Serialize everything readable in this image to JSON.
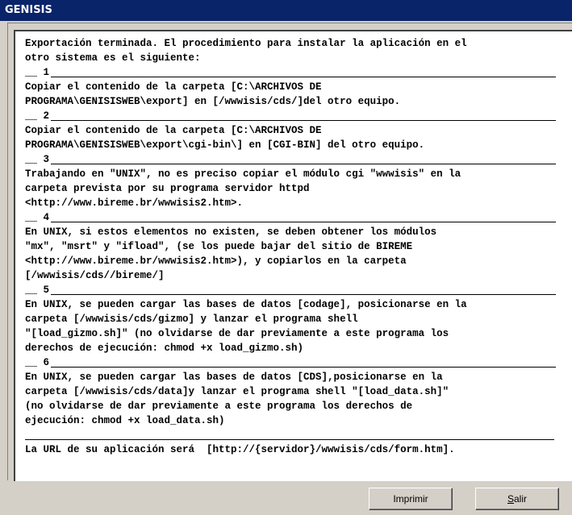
{
  "window": {
    "title": "GENISIS"
  },
  "message": {
    "intro": [
      "Exportación terminada. El procedimiento para instalar la aplicación en el",
      "otro sistema es el siguiente:"
    ],
    "steps": [
      {
        "number": "__ 1",
        "lines": [
          "Copiar el contenido de la carpeta [C:\\ARCHIVOS DE",
          "PROGRAMA\\GENISISWEB\\export] en [/wwwisis/cds/]del otro equipo."
        ]
      },
      {
        "number": "__ 2",
        "lines": [
          "Copiar el contenido de la carpeta [C:\\ARCHIVOS DE",
          "PROGRAMA\\GENISISWEB\\export\\cgi-bin\\] en [CGI-BIN] del otro equipo."
        ]
      },
      {
        "number": "__ 3",
        "lines": [
          "Trabajando en \"UNIX\", no es preciso copiar el módulo cgi \"wwwisis\" en la",
          "carpeta prevista por su programa servidor httpd",
          "<http://www.bireme.br/wwwisis2.htm>."
        ]
      },
      {
        "number": "__ 4",
        "lines": [
          "En UNIX, si estos elementos no existen, se deben obtener los módulos",
          "\"mx\", \"msrt\" y \"ifload\", (se los puede bajar del sitio de BIREME",
          "<http://www.bireme.br/wwwisis2.htm>), y copiarlos en la carpeta",
          "[/wwwisis/cds//bireme/]"
        ]
      },
      {
        "number": "__ 5",
        "lines": [
          "En UNIX, se pueden cargar las bases de datos [codage], posicionarse en la",
          "carpeta [/wwwisis/cds/gizmo] y lanzar el programa shell",
          "\"[load_gizmo.sh]\" (no olvidarse de dar previamente a este programa los",
          "derechos de ejecución: chmod +x load_gizmo.sh)"
        ]
      },
      {
        "number": "__ 6",
        "lines": [
          "En UNIX, se pueden cargar las bases de datos [CDS],posicionarse en la",
          "carpeta [/wwwisis/cds/data]y lanzar el programa shell \"[load_data.sh]\"",
          "(no olvidarse de dar previamente a este programa los derechos de",
          "ejecución: chmod +x load_data.sh)"
        ]
      }
    ],
    "final": "La URL de su aplicación será  [http://{servidor}/wwwisis/cds/form.htm]."
  },
  "buttons": {
    "print": "Imprimir",
    "exit_accel": "S",
    "exit_rest": "alir"
  }
}
